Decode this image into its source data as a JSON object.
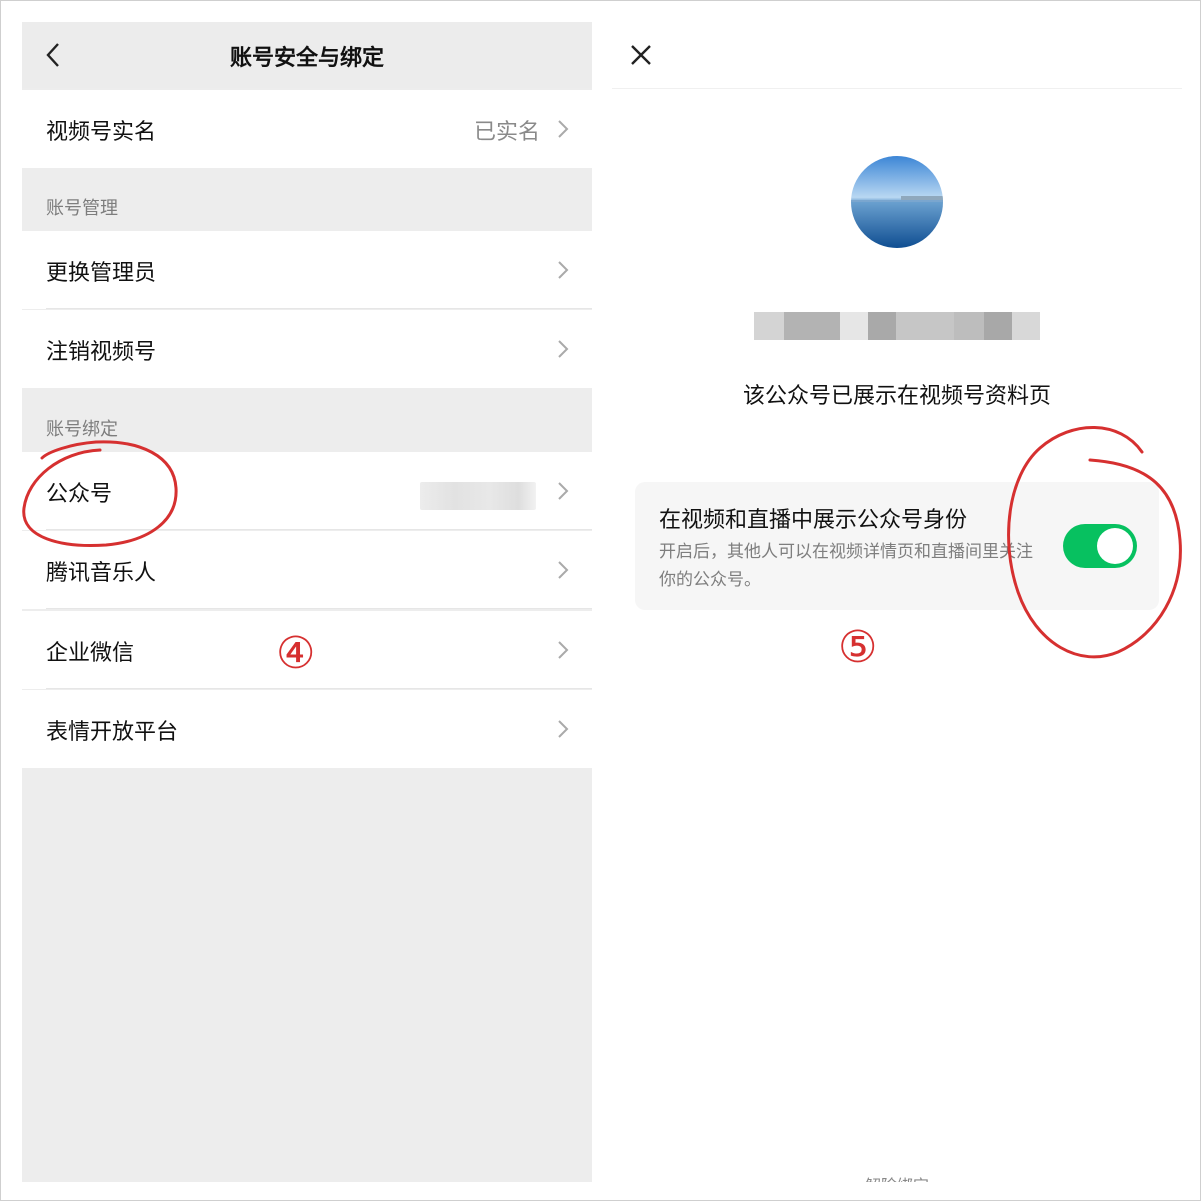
{
  "left": {
    "title": "账号安全与绑定",
    "realname_row": {
      "label": "视频号实名",
      "value": "已实名"
    },
    "section_manage": "账号管理",
    "manage_items": [
      {
        "label": "更换管理员"
      },
      {
        "label": "注销视频号"
      }
    ],
    "section_bind": "账号绑定",
    "bind_items": [
      {
        "label": "公众号"
      },
      {
        "label": "腾讯音乐人"
      },
      {
        "label": "企业微信"
      },
      {
        "label": "表情开放平台"
      }
    ]
  },
  "right": {
    "caption": "该公众号已展示在视频号资料页",
    "card": {
      "title": "在视频和直播中展示公众号身份",
      "desc": "开启后，其他人可以在视频详情页和直播间里关注你的公众号。",
      "toggle_on": true
    },
    "footer": "解除绑定"
  },
  "annotations": {
    "left_number": "④",
    "right_number": "⑤",
    "color": "#d63030"
  },
  "colors": {
    "toggle": "#07c160"
  }
}
